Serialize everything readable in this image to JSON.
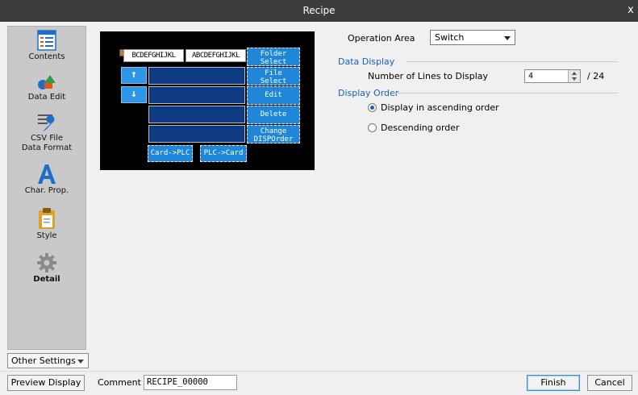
{
  "window": {
    "title": "Recipe",
    "close_label": "x"
  },
  "sidebar": {
    "items": [
      {
        "label": "Contents",
        "icon": "contents-icon"
      },
      {
        "label": "Data Edit",
        "icon": "data-edit-icon"
      },
      {
        "label": "CSV File Data Format",
        "label_line1": "CSV File",
        "label_line2": "Data Format",
        "icon": "wrench-icon"
      },
      {
        "label": "Char. Prop.",
        "icon": "char-prop-icon"
      },
      {
        "label": "Style",
        "icon": "style-icon"
      },
      {
        "label": "Detail",
        "icon": "gear-icon"
      }
    ],
    "other_settings_label": "Other Settings"
  },
  "preview": {
    "label1": "BCDEFGHIJKL",
    "label2": "ABCDEFGHIJKL",
    "folder_select": [
      "Folder",
      "Select"
    ],
    "file_select": [
      "File",
      "Select"
    ],
    "edit": "Edit",
    "delete": "Delete",
    "change_disporder": [
      "Change",
      "DISPOrder"
    ],
    "card_to_plc": "Card->PLC",
    "plc_to_card": "PLC->Card",
    "up_arrow": "↑",
    "down_arrow": "↓"
  },
  "form": {
    "operation_area_label": "Operation Area",
    "operation_area_value": "Switch",
    "data_display_title": "Data Display",
    "lines_label": "Number of Lines to Display",
    "lines_value": "4",
    "lines_max": "/ 24",
    "display_order_title": "Display Order",
    "order_options": [
      {
        "label": "Display in ascending order",
        "selected": true
      },
      {
        "label": "Descending order",
        "selected": false
      }
    ]
  },
  "footer": {
    "preview_display": "Preview Display",
    "comment_label": "Comment",
    "comment_value": "RECIPE_00000",
    "finish": "Finish",
    "cancel": "Cancel"
  },
  "colors": {
    "title_bar": "#3c3c3c",
    "sidebar_bg": "#c9c9c9",
    "section_title": "#1a5fb4",
    "preview_button": "#1f86d8",
    "preview_field": "#0e3a82"
  }
}
